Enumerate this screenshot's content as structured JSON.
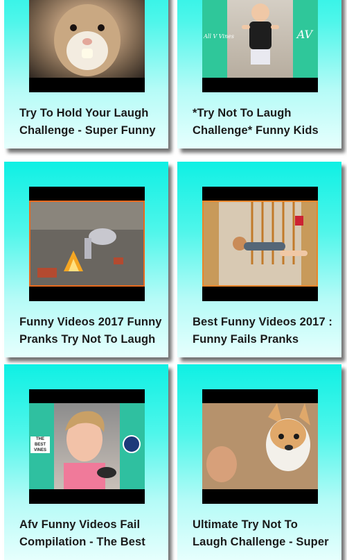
{
  "videos": [
    {
      "title": "Try To Hold Your Laugh\nChallenge - Super Funny",
      "thumb": "hamster-eating"
    },
    {
      "title": "*Try Not To Laugh\nChallenge* Funny Kids",
      "thumb": "toddler-dancing"
    },
    {
      "title": "Funny Videos 2017 Funny\nPranks Try Not To Laugh",
      "thumb": "man-over-fire"
    },
    {
      "title": "Best Funny Videos 2017 :\nFunny Fails Pranks",
      "thumb": "kid-stuck-in-gate"
    },
    {
      "title": "Afv Funny Videos Fail\nCompilation - The Best",
      "thumb": "girl-in-car"
    },
    {
      "title": "Ultimate Try Not To\nLaugh Challenge - Super",
      "thumb": "corgi-dog"
    }
  ],
  "overlays": {
    "left_watermark": "All V Vines",
    "right_watermark": "AV",
    "best_vines": "THE BEST\nVINES"
  }
}
